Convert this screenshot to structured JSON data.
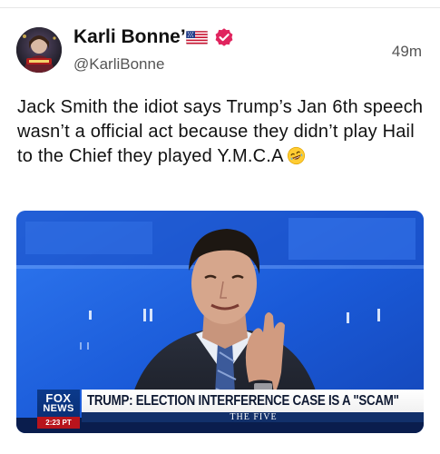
{
  "post": {
    "author": {
      "display_name": "Karli Bonne’",
      "handle": "@KarliBonne",
      "flag_icon": "us-flag-icon",
      "verified_icon": "verified-badge-icon",
      "verified_color": "#e0245e"
    },
    "timestamp": "49m",
    "text": "Jack Smith the idiot says Trump’s Jan 6th speech wasn’t a official act because they didn’t play Hail to the Chief they played Y.M.C.A",
    "emoji": "rolling-on-floor-laughing-icon"
  },
  "media": {
    "network_logo_line1": "FOX",
    "network_logo_line2": "NEWS",
    "time": "2:23 PT",
    "chyron": "TRUMP: ELECTION INTERFERENCE CASE IS A \"SCAM\"",
    "show_name": "THE FIVE"
  },
  "colors": {
    "text": "#111111",
    "secondary_text": "#555555",
    "studio_blue": "#1f5fd6",
    "chyron_navy": "#12306a"
  }
}
